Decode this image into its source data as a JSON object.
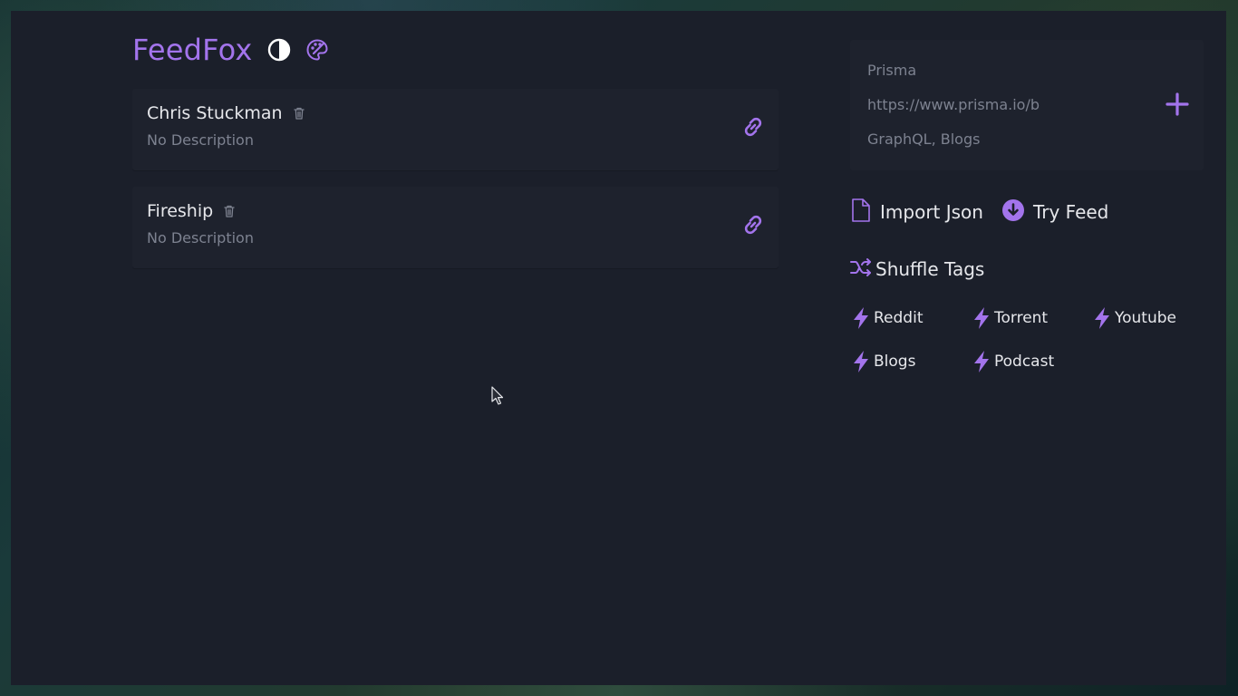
{
  "app": {
    "title": "FeedFox"
  },
  "header": {
    "theme_toggle_icon": "contrast-icon",
    "palette_icon": "palette-icon"
  },
  "feeds": [
    {
      "title": "Chris Stuckman",
      "description": "No Description"
    },
    {
      "title": "Fireship",
      "description": "No Description"
    }
  ],
  "form": {
    "name_value": "Prisma",
    "url_value": "https://www.prisma.io/b",
    "tags_value": "GraphQL, Blogs"
  },
  "actions": {
    "import_label": "Import Json",
    "try_label": "Try Feed"
  },
  "shuffle": {
    "label": "Shuffle Tags"
  },
  "tags": [
    "Reddit",
    "Torrent",
    "Youtube",
    "Blogs",
    "Podcast"
  ],
  "colors": {
    "accent": "#a374ec",
    "background": "#1b1f2a",
    "card": "#1e222d",
    "text": "#e6e7eb",
    "muted": "#7d8290"
  }
}
